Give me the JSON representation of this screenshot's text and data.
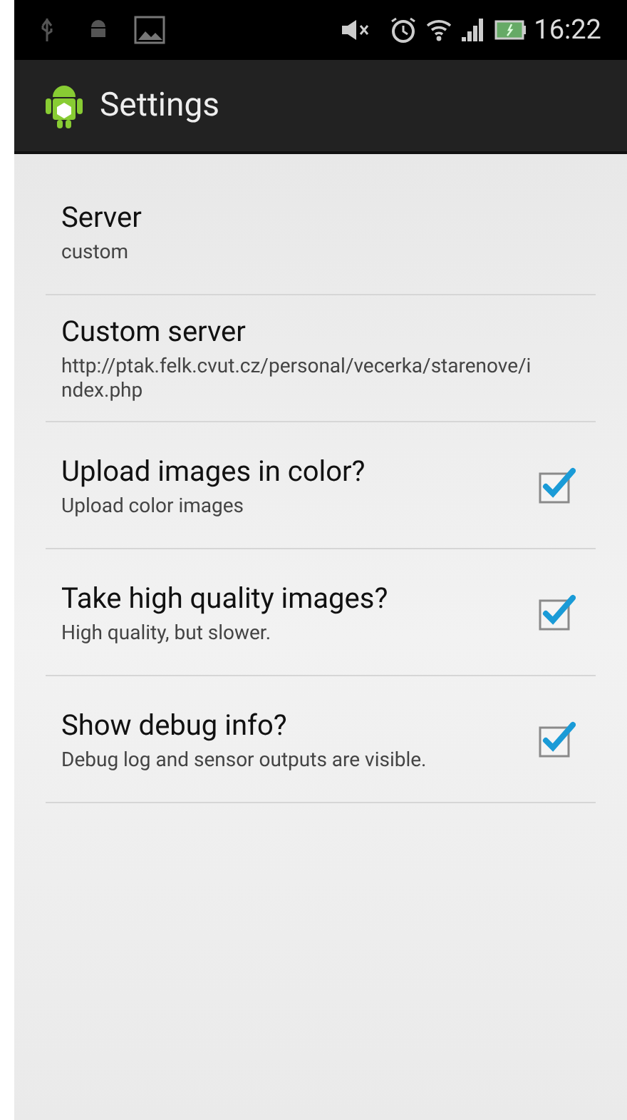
{
  "status_bar": {
    "time": "16:22"
  },
  "action_bar": {
    "title": "Settings"
  },
  "preferences": [
    {
      "kind": "text",
      "title": "Server",
      "summary": "custom"
    },
    {
      "kind": "text",
      "title": "Custom server",
      "summary": "http://ptak.felk.cvut.cz/personal/vecerka/starenove/index.php"
    },
    {
      "kind": "checkbox",
      "title": "Upload images in color?",
      "summary": "Upload color images",
      "checked": true
    },
    {
      "kind": "checkbox",
      "title": "Take high quality images?",
      "summary": "High quality, but slower.",
      "checked": true
    },
    {
      "kind": "checkbox",
      "title": "Show debug info?",
      "summary": "Debug log and sensor outputs are visible.",
      "checked": true
    }
  ]
}
